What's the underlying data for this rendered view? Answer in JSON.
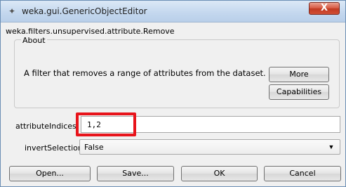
{
  "window": {
    "title": "weka.gui.GenericObjectEditor",
    "close_glyph": "X"
  },
  "editor": {
    "class_name": "weka.filters.unsupervised.attribute.Remove"
  },
  "about": {
    "legend": "About",
    "text": "A filter that removes a range of attributes from the dataset.",
    "more_label": "More",
    "capabilities_label": "Capabilities"
  },
  "properties": {
    "attribute_indices_label": "attributeIndices",
    "attribute_indices_value": "1,2",
    "invert_selection_label": "invertSelection",
    "invert_selection_value": "False"
  },
  "buttons": {
    "open": "Open...",
    "save": "Save...",
    "ok": "OK",
    "cancel": "Cancel"
  },
  "highlight_color": "#e8141b"
}
